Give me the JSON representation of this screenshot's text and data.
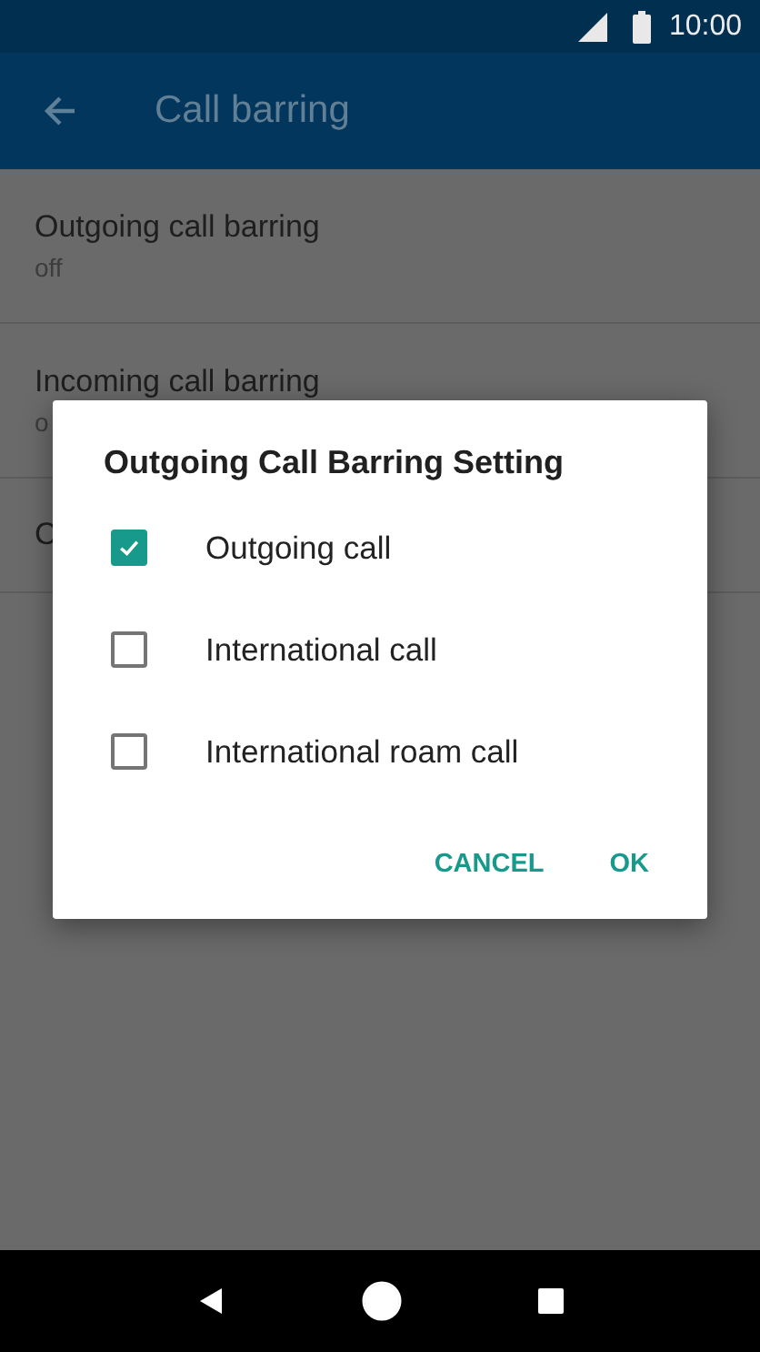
{
  "status_bar": {
    "time": "10:00"
  },
  "app_bar": {
    "title": "Call barring"
  },
  "settings": [
    {
      "title": "Outgoing call barring",
      "summary": "off"
    },
    {
      "title": "Incoming call barring",
      "summary": "o"
    },
    {
      "title": "C"
    }
  ],
  "dialog": {
    "title": "Outgoing Call Barring Setting",
    "options": [
      {
        "label": "Outgoing call",
        "checked": true
      },
      {
        "label": "International call",
        "checked": false
      },
      {
        "label": "International roam call",
        "checked": false
      }
    ],
    "buttons": [
      "CANCEL",
      "OK"
    ]
  }
}
